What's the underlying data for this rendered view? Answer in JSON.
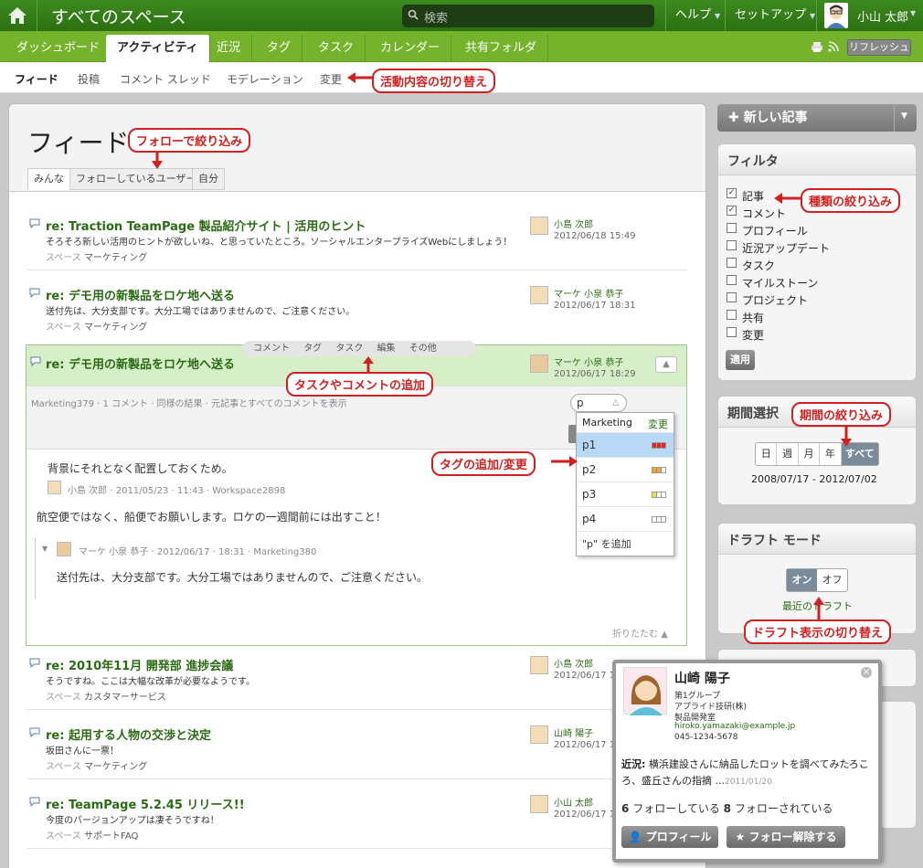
{
  "header": {
    "space_title": "すべてのスペース",
    "search_placeholder": "検索",
    "help": "ヘルプ",
    "setup": "セットアップ",
    "user": "小山 太郎"
  },
  "tabs": [
    "ダッシュボード",
    "アクティビティ",
    "近況",
    "タグ",
    "タスク",
    "カレンダー",
    "共有フォルダ"
  ],
  "refresh_label": "リフレッシュ",
  "subnav": [
    "フィード",
    "投稿",
    "コメント スレッド",
    "モデレーション",
    "変更"
  ],
  "annotations": {
    "activity_switch": "活動内容の切り替え",
    "follow_filter": "フォローで絞り込み",
    "type_filter": "種類の絞り込み",
    "period_filter": "期間の絞り込み",
    "task_comment": "タスクやコメントの追加",
    "tag_edit": "タグの追加/変更",
    "draft_toggle": "ドラフト表示の切り替え"
  },
  "feed": {
    "title": "フィード",
    "tabs": [
      "みんな",
      "フォローしているユーザー",
      "自分"
    ]
  },
  "posts": [
    {
      "title": "re: Traction TeamPage 製品紹介サイト | 活用のヒント",
      "excerpt": "そろそろ新しい活用のヒントが欲しいね、と思っていたところ。ソーシャルエンタープライズWebにしましょう！",
      "space": "マーケティング",
      "author": "小島 次郎",
      "date": "2012/06/18 15:49"
    },
    {
      "title": "re: デモ用の新製品をロケ地へ送る",
      "excerpt": "送付先は、大分支部です。大分工場ではありませんので、ご注意ください。",
      "space": "マーケティング",
      "author": "マーケ 小泉 恭子",
      "date": "2012/06/17 18:31"
    },
    {
      "title": "re: 2010年11月 開発部 進捗会議",
      "excerpt": "そうですね。ここは大幅な改革が必要なようです。",
      "space": "カスタマーサービス",
      "author": "小島 次郎",
      "date": "2012/06/17 1"
    },
    {
      "title": "re: 起用する人物の交渉と決定",
      "excerpt": "坂田さんに一票！",
      "space": "マーケティング",
      "author": "山崎 陽子",
      "date": "2012/06/17 1"
    },
    {
      "title": "re: TeamPage 5.2.45 リリース!!",
      "excerpt": "今度のバージョンアップは凄そうですね！",
      "space": "サポートFAQ",
      "author": "小山 太郎",
      "date": "2012/06/17 1"
    }
  ],
  "space_label": "スペース",
  "expanded": {
    "title": "re: デモ用の新製品をロケ地へ送る",
    "author": "マーケ 小泉 恭子",
    "date": "2012/06/17 18:29",
    "toolbar": [
      "コメント",
      "タグ",
      "タスク",
      "編集",
      "その他"
    ],
    "meta": "Marketing379 · 1 コメント · 同様の結果 · 元記事とすべてのコメントを表示",
    "quote": "背景にそれとなく配置しておくため。",
    "quote_meta": "小島 次郎 · 2011/05/23 · 11:43 · Workspace2898",
    "body": "航空便ではなく、船便でお願いします。ロケの一週間前には出すこと！",
    "comment_meta": "マーケ 小泉 恭子 · 2012/06/17 · 18:31 · Marketing380",
    "comment_body": "送付先は、大分支部です。大分工場ではありませんので、ご注意ください。",
    "collapse": "折りたたむ",
    "tag_input": "p"
  },
  "tag_dropdown": {
    "header": "Marketing",
    "change": "変更",
    "items": [
      "p1",
      "p2",
      "p3",
      "p4"
    ],
    "add": "\"p\" を追加"
  },
  "right": {
    "new_post": "新しい記事",
    "filter_title": "フィルタ",
    "filters": [
      {
        "label": "記事",
        "checked": true
      },
      {
        "label": "コメント",
        "checked": true
      },
      {
        "label": "プロフィール",
        "checked": false
      },
      {
        "label": "近況アップデート",
        "checked": false
      },
      {
        "label": "タスク",
        "checked": false
      },
      {
        "label": "マイルストーン",
        "checked": false
      },
      {
        "label": "プロジェクト",
        "checked": false
      },
      {
        "label": "共有",
        "checked": false
      },
      {
        "label": "変更",
        "checked": false
      }
    ],
    "apply": "適用",
    "period_title": "期間選択",
    "period_buttons": [
      "日",
      "週",
      "月",
      "年",
      "すべて"
    ],
    "period_range": "2008/07/17 - 2012/07/02",
    "draft_title": "ドラフト モード",
    "draft_on": "オン",
    "draft_off": "オフ",
    "recent_draft": "最近のドラフト"
  },
  "popup": {
    "name": "山崎 陽子",
    "group": "第1グループ",
    "company": "アプライド技研(株)",
    "dept": "製品開発室",
    "email": "hiroko.yamazaki@example.jp",
    "phone": "045-1234-5678",
    "status_label": "近況:",
    "status_text": "横浜建設さんに納品したロットを調べてみたろころ、盛丘さんの指摘 ...",
    "status_date": "2011/01/20",
    "following_count": "6",
    "following_label": "フォローしている",
    "followers_count": "8",
    "followers_label": "フォローされている",
    "profile_btn": "プロフィール",
    "unfollow_btn": "フォロー解除する"
  }
}
